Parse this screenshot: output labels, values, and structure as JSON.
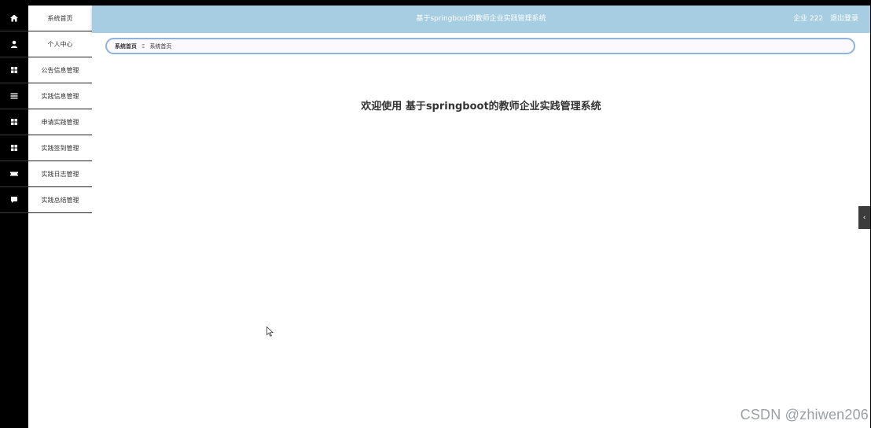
{
  "header": {
    "title": "基于springboot的教师企业实践管理系统",
    "user_label": "企业 222",
    "logout_label": "退出登录"
  },
  "menu": {
    "items": [
      {
        "label": "系统首页",
        "icon": "home-icon"
      },
      {
        "label": "个人中心",
        "icon": "user-icon"
      },
      {
        "label": "公告信息管理",
        "icon": "grid-icon"
      },
      {
        "label": "实践信息管理",
        "icon": "list-icon"
      },
      {
        "label": "申请实践管理",
        "icon": "grid-icon"
      },
      {
        "label": "实践签到管理",
        "icon": "grid-icon"
      },
      {
        "label": "实践日志管理",
        "icon": "ticket-icon"
      },
      {
        "label": "实践总结管理",
        "icon": "comment-icon"
      }
    ]
  },
  "breadcrumb": {
    "root": "系统首页",
    "separator": "Ξ",
    "current": "系统首页"
  },
  "main": {
    "welcome": "欢迎使用 基于springboot的教师企业实践管理系统"
  },
  "side_toggle": {
    "label": "‹"
  },
  "watermark": "CSDN @zhiwen206",
  "colors": {
    "header_bg": "#a7cde2",
    "rail_bg": "#000000",
    "breadcrumb_border": "#8fb4db"
  }
}
